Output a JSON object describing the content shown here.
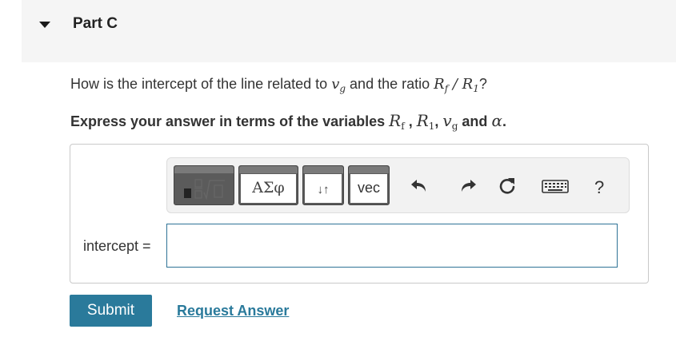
{
  "part": {
    "title": "Part C"
  },
  "question": {
    "prefix": "How is the intercept of the line related to ",
    "var1": "v",
    "var1_sub": "g",
    "middle": " and the ratio ",
    "ratio_num": "R",
    "ratio_num_sub": "f",
    "ratio_sep": " / ",
    "ratio_den": "R",
    "ratio_den_sub": "1",
    "suffix": "?"
  },
  "instruction": {
    "prefix": "Express your answer in terms of the variables ",
    "v1": "R",
    "v1_sub": "f",
    "sep1": " , ",
    "v2": "R",
    "v2_sub": "1",
    "sep2": ", ",
    "v3": "v",
    "v3_sub": "g",
    "sep3": " and ",
    "v4": "α",
    "suffix": "."
  },
  "toolbar": {
    "greek_label": "ΑΣφ",
    "arrows_label": "↓↑",
    "vec_label": "vec",
    "help_label": "?"
  },
  "answer": {
    "label": "intercept =",
    "value": ""
  },
  "actions": {
    "submit_label": "Submit",
    "request_label": "Request Answer"
  },
  "colors": {
    "accent": "#2a7a9b",
    "header_bg": "#f5f5f5",
    "toolbar_button": "#5b5b5b"
  }
}
